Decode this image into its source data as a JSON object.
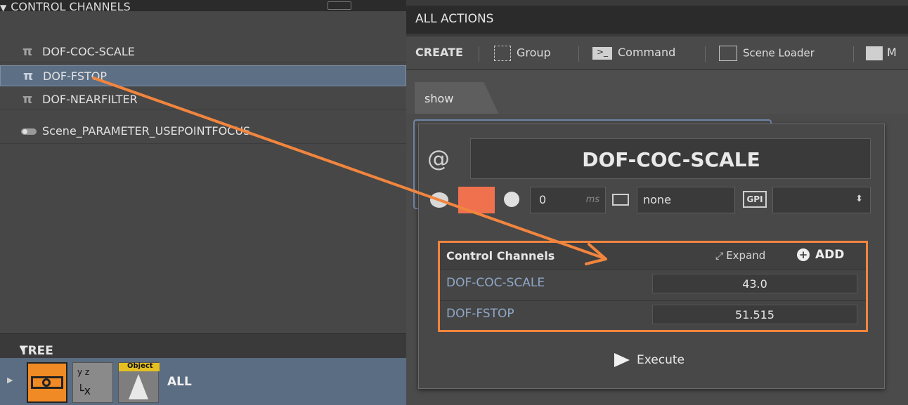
{
  "left_panel": {
    "header": "CONTROL CHANNELS",
    "channels": [
      {
        "label": "DOF-COC-SCALE",
        "icon": "pi-icon"
      },
      {
        "label": "DOF-FSTOP",
        "icon": "pi-icon",
        "selected": true
      },
      {
        "label": "DOF-NEARFILTER",
        "icon": "pi-icon"
      },
      {
        "label": "Scene_PARAMETER_USEPOINTFOCUS",
        "icon": "toggle-icon"
      }
    ],
    "tree_header": "TREE",
    "tree_item_label": "ALL",
    "tree_object_tag": "Object"
  },
  "right_panel": {
    "header": "ALL ACTIONS",
    "toolbar": {
      "create_label": "CREATE",
      "group_label": "Group",
      "command_label": "Command",
      "scene_loader_label": "Scene Loader",
      "cut_label": "M"
    },
    "tab_label": "show",
    "card": {
      "title": "DOF-COC-SCALE",
      "color_swatch": "#f0714e",
      "delay_value": "0",
      "delay_unit": "ms",
      "keyboard_value": "none",
      "gpi_label": "GPI",
      "gpi_value": "",
      "control_channels": {
        "header": "Control Channels",
        "expand_label": "Expand",
        "add_label": "ADD",
        "rows": [
          {
            "name": "DOF-COC-SCALE",
            "value": "43.0"
          },
          {
            "name": "DOF-FSTOP",
            "value": "51.515"
          }
        ]
      },
      "execute_label": "Execute"
    }
  },
  "colors": {
    "accent": "#f2853e",
    "selection": "#5d6f85"
  }
}
